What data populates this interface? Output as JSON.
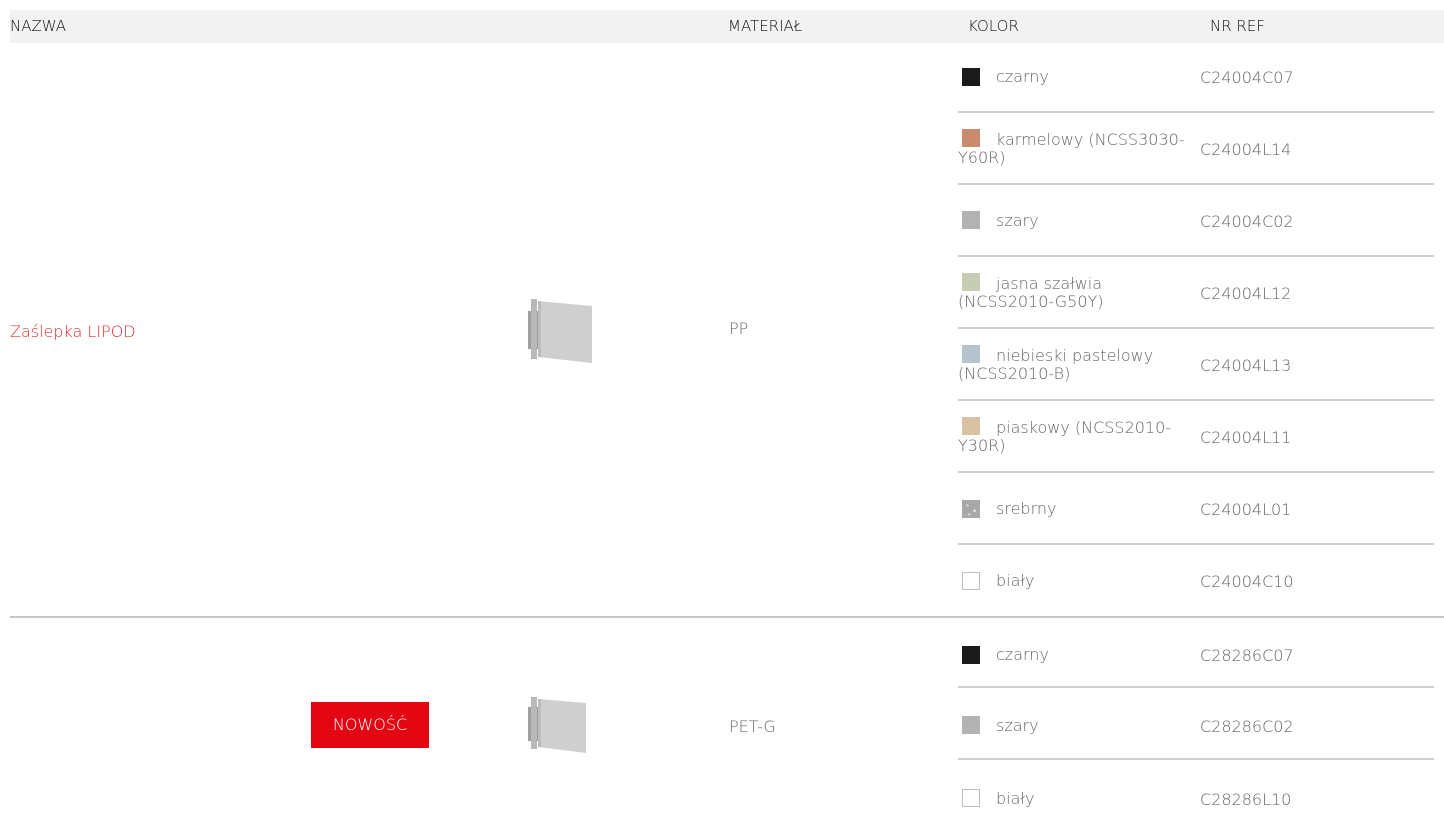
{
  "header": {
    "col_name": "NAZWA",
    "col_material": "MATERIAŁ",
    "col_color": "KOLOR",
    "col_ref": "NR REF"
  },
  "products": [
    {
      "name": "Zaślepka LIPOD",
      "badge": "",
      "image_icon": "end-cap-image",
      "material": "PP",
      "variants": [
        {
          "color": "czarny",
          "swatch": "#1a1a1a",
          "ref": "C24004C07"
        },
        {
          "color": "karmelowy (NCSS3030-Y60R)",
          "swatch": "#c98a6e",
          "ref": "C24004L14"
        },
        {
          "color": "szary",
          "swatch": "#b3b3b3",
          "ref": "C24004C02"
        },
        {
          "color": "jasna szałwia (NCSS2010-G50Y)",
          "swatch": "#c7cdb4",
          "ref": "C24004L12"
        },
        {
          "color": "niebieski pastelowy (NCSS2010-B)",
          "swatch": "#b4c3cc",
          "ref": "C24004L13"
        },
        {
          "color": "piaskowy (NCSS2010-Y30R)",
          "swatch": "#d9c2a4",
          "ref": "C24004L11"
        },
        {
          "color": "srebrny",
          "swatch": "#a8a8a8",
          "ref": "C24004L01"
        },
        {
          "color": "biały",
          "swatch": "#ffffff",
          "ref": "C24004C10"
        }
      ]
    },
    {
      "name": "",
      "badge": "NOWOŚĆ",
      "image_icon": "end-cap-image",
      "material": "PET-G",
      "variants": [
        {
          "color": "czarny",
          "swatch": "#1a1a1a",
          "ref": "C28286C07"
        },
        {
          "color": "szary",
          "swatch": "#b3b3b3",
          "ref": "C28286C02"
        },
        {
          "color": "biały",
          "swatch": "#ffffff",
          "ref": "C28286L10"
        }
      ]
    }
  ]
}
